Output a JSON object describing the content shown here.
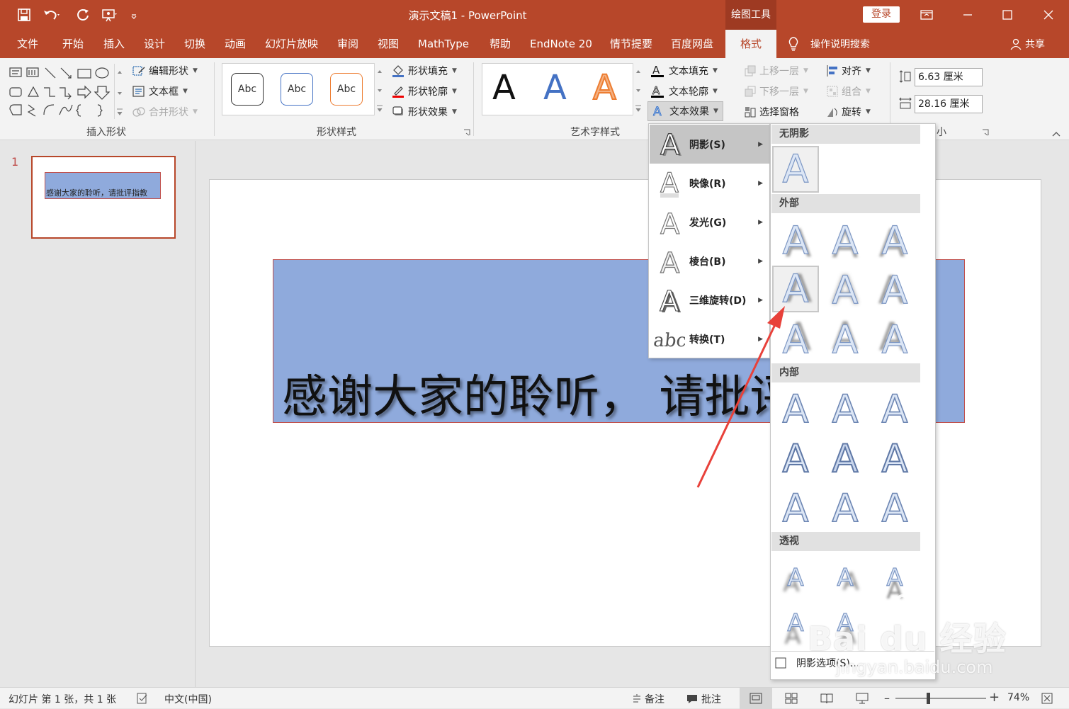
{
  "app": {
    "title": "演示文稿1 - PowerPoint",
    "contextual_tab_group": "绘图工具",
    "login_label": "登录",
    "share_label": "共享",
    "tell_me": "操作说明搜索"
  },
  "tabs": [
    "文件",
    "开始",
    "插入",
    "设计",
    "切换",
    "动画",
    "幻灯片放映",
    "审阅",
    "视图",
    "MathType",
    "帮助",
    "EndNote 20",
    "情节提要",
    "百度网盘",
    "格式"
  ],
  "ribbon": {
    "insert_shapes": {
      "label": "插入形状",
      "edit_shape": "编辑形状",
      "text_box": "文本框",
      "merge_shapes": "合并形状"
    },
    "shape_styles": {
      "label": "形状样式",
      "swatches": [
        "Abc",
        "Abc",
        "Abc"
      ],
      "fill": "形状填充",
      "outline": "形状轮廓",
      "effects": "形状效果"
    },
    "wordart_styles": {
      "label": "艺术字样式",
      "samples": [
        "A",
        "A",
        "A"
      ],
      "text_fill": "文本填充",
      "text_outline": "文本轮廓",
      "text_effects": "文本效果"
    },
    "arrange": {
      "bring_forward": "上移一层",
      "send_backward": "下移一层",
      "selection_pane": "选择窗格",
      "align": "对齐",
      "group": "组合",
      "rotate": "旋转"
    },
    "size": {
      "label_partial": "小",
      "height": "6.63 厘米",
      "width": "28.16 厘米"
    }
  },
  "thumbnails": [
    {
      "number": "1",
      "text": "感谢大家的聆听，请批评指教"
    }
  ],
  "slide": {
    "text": "感谢大家的聆听， 请批评指教"
  },
  "text_effects_menu": [
    {
      "label": "阴影(S)",
      "icon": "shadow-a-icon",
      "active": true
    },
    {
      "label": "映像(R)",
      "icon": "reflection-a-icon"
    },
    {
      "label": "发光(G)",
      "icon": "glow-a-icon"
    },
    {
      "label": "棱台(B)",
      "icon": "bevel-a-icon"
    },
    {
      "label": "三维旋转(D)",
      "icon": "3d-rotation-a-icon"
    },
    {
      "label": "转换(T)",
      "icon": "transform-abc-icon"
    }
  ],
  "shadow_gallery": {
    "no_shadow": "无阴影",
    "outer": "外部",
    "inner": "内部",
    "perspective": "透视",
    "options": "阴影选项(S)...",
    "glyph": "A"
  },
  "statusbar": {
    "slide_info": "幻灯片 第 1 张，共 1 张",
    "language": "中文(中国)",
    "notes": "备注",
    "comments": "批注",
    "zoom": "74%"
  },
  "watermark": {
    "brand": "Bai du 经验",
    "url": "jingyan.baidu.com"
  },
  "colors": {
    "accent": "#b7472a",
    "textbox_fill": "#8faadc",
    "textbox_border": "#c0504d",
    "annotation_arrow": "#e8413a"
  }
}
